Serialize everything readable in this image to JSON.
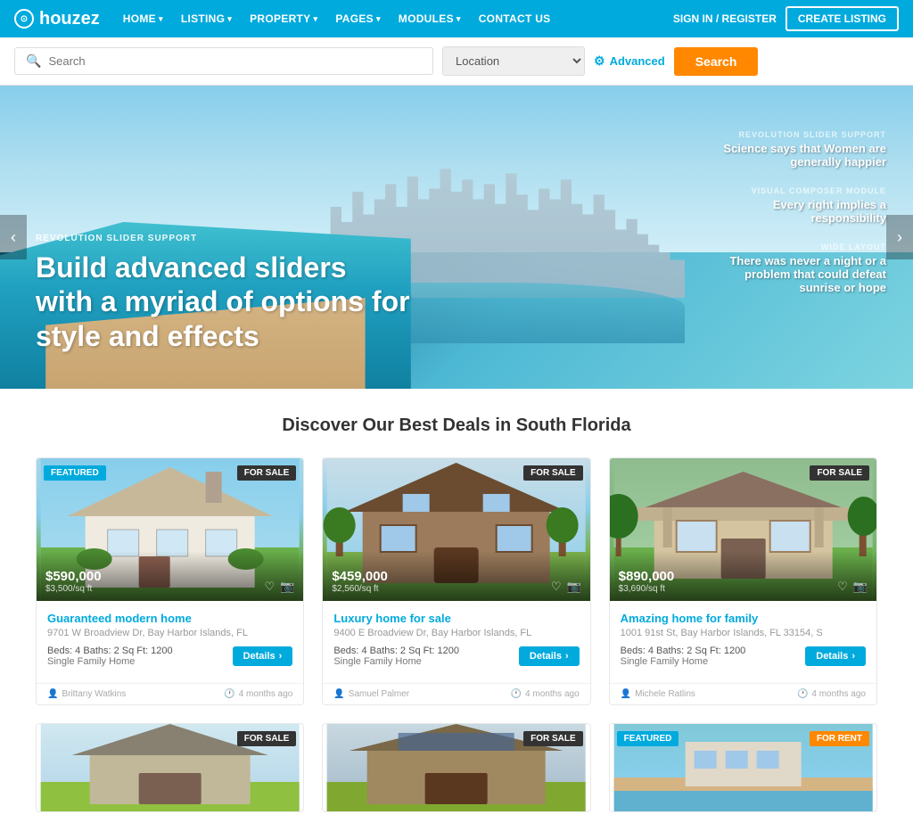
{
  "brand": {
    "name": "houzez",
    "logo_icon": "⊙"
  },
  "navbar": {
    "items": [
      {
        "label": "HOME",
        "has_dropdown": true
      },
      {
        "label": "LISTING",
        "has_dropdown": true
      },
      {
        "label": "PROPERTY",
        "has_dropdown": true
      },
      {
        "label": "PAGES",
        "has_dropdown": true
      },
      {
        "label": "MODULES",
        "has_dropdown": true
      },
      {
        "label": "CONTACT US",
        "has_dropdown": false
      }
    ],
    "sign_in_label": "SIGN IN / REGISTER",
    "create_listing_label": "CREATE LISTING"
  },
  "search_bar": {
    "placeholder": "Search",
    "location_label": "Location",
    "advanced_label": "Advanced",
    "search_btn_label": "Search"
  },
  "hero": {
    "slider_label": "REVOLUTION SLIDER SUPPORT",
    "title": "Build advanced sliders with a myriad of options for style and effects",
    "side_items": [
      {
        "label": "REVOLUTION SLIDER SUPPORT",
        "text": "Science says that Women are generally happier"
      },
      {
        "label": "VISUAL COMPOSER MODULE",
        "text": "Every right implies a responsibility"
      },
      {
        "label": "WIDE LAYOUT",
        "text": "There was never a night or a problem that could defeat sunrise or hope"
      }
    ]
  },
  "section": {
    "title": "Discover Our Best Deals in South Florida"
  },
  "properties": [
    {
      "id": 1,
      "featured": true,
      "badge": "FOR SALE",
      "badge_type": "sale",
      "price": "$590,000",
      "price_sqft": "$3,500/sq ft",
      "title": "Guaranteed modern home",
      "address": "9701 W Broadview Dr, Bay Harbor Islands, FL",
      "beds": 4,
      "baths": 2,
      "sqft": 1200,
      "type": "Single Family Home",
      "author": "Brittany Watkins",
      "date": "4 months ago",
      "house_class": "house-white"
    },
    {
      "id": 2,
      "featured": false,
      "badge": "FOR SALE",
      "badge_type": "sale",
      "price": "$459,000",
      "price_sqft": "$2,560/sq ft",
      "title": "Luxury home for sale",
      "address": "9400 E Broadview Dr, Bay Harbor Islands, FL",
      "beds": 4,
      "baths": 2,
      "sqft": 1200,
      "type": "Single Family Home",
      "author": "Samuel Palmer",
      "date": "4 months ago",
      "house_class": "house-brown"
    },
    {
      "id": 3,
      "featured": false,
      "badge": "FOR SALE",
      "badge_type": "sale",
      "price": "$890,000",
      "price_sqft": "$3,690/sq ft",
      "title": "Amazing home for family",
      "address": "1001 91st St, Bay Harbor Islands, FL 33154, S",
      "beds": 4,
      "baths": 2,
      "sqft": 1200,
      "type": "Single Family Home",
      "author": "Michele Ratlins",
      "date": "4 months ago",
      "house_class": "house-beige"
    }
  ],
  "properties_row2": [
    {
      "id": 4,
      "featured": false,
      "badge": "FOR SALE",
      "badge_type": "sale",
      "house_class": "house-row2-1"
    },
    {
      "id": 5,
      "featured": false,
      "badge": "FOR SALE",
      "badge_type": "sale",
      "house_class": "house-row2-2"
    },
    {
      "id": 6,
      "featured": true,
      "badge": "FOR RENT",
      "badge_type": "rent",
      "house_class": "house-row2-3"
    }
  ],
  "labels": {
    "details": "Details",
    "beds_prefix": "Beds:",
    "baths_prefix": "Baths:",
    "sqft_prefix": "Sq Ft:",
    "chevron": "›",
    "person_icon": "👤",
    "clock_icon": "🕐"
  }
}
